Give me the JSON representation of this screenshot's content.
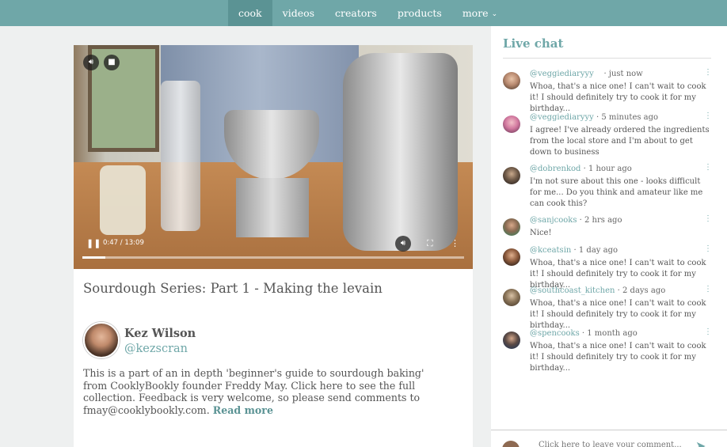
{
  "nav": {
    "items": [
      {
        "label": "cook",
        "active": true
      },
      {
        "label": "videos",
        "active": false
      },
      {
        "label": "creators",
        "active": false
      },
      {
        "label": "products",
        "active": false
      },
      {
        "label": "more",
        "active": false
      }
    ]
  },
  "video": {
    "time": "0:47 / 13:09",
    "progress_fraction": 0.06
  },
  "post": {
    "title": "Sourdough Series: Part 1 - Making the levain",
    "author_name": "Kez Wilson",
    "author_handle": "@kezscran",
    "description": "This is a part of an in depth 'beginner's guide to sourdough baking' from CooklyBookly founder Freddy May. Click here to see the full collection. Feedback is very welcome, so please send comments to fmay@cooklybookly.com.",
    "read_more": "Read more"
  },
  "chat": {
    "title": "Live chat",
    "messages": [
      {
        "user": "@veggiediaryyy",
        "time": "    · just now",
        "text": "Whoa, that's a nice one! I can't wait to cook it! I should definitely try to cook it for my birthday..."
      },
      {
        "user": "@veggiediaryyy",
        "time": " · 5 minutes ago",
        "text": "I agree! I've already ordered the ingredients from the local store and I'm about to get down to business"
      },
      {
        "user": "@dobrenkod",
        "time": " · 1 hour ago",
        "text": "I'm not sure about this one - looks difficult for me... Do you think and amateur like me can cook this?"
      },
      {
        "user": "@sanjcooks",
        "time": " · 2 hrs ago",
        "text": "Nice!"
      },
      {
        "user": "@kceatsin",
        "time": " · 1 day ago",
        "text": "Whoa, that's a nice one! I can't wait to cook it! I should definitely try to cook it for my birthday..."
      },
      {
        "user": "@southcoast_kitchen",
        "time": " · 2 days ago",
        "text": "Whoa, that's a nice one! I can't wait to cook it! I should definitely try to cook it for my birthday..."
      },
      {
        "user": "@spencooks",
        "time": " · 1 month ago",
        "text": "Whoa, that's a nice one! I can't wait to cook it! I should definitely try to cook it for my birthday..."
      }
    ],
    "composer_placeholder": "Click here to leave your comment..."
  },
  "colors": {
    "accent": "#6fa7a8",
    "nav_active": "#5b9394"
  }
}
